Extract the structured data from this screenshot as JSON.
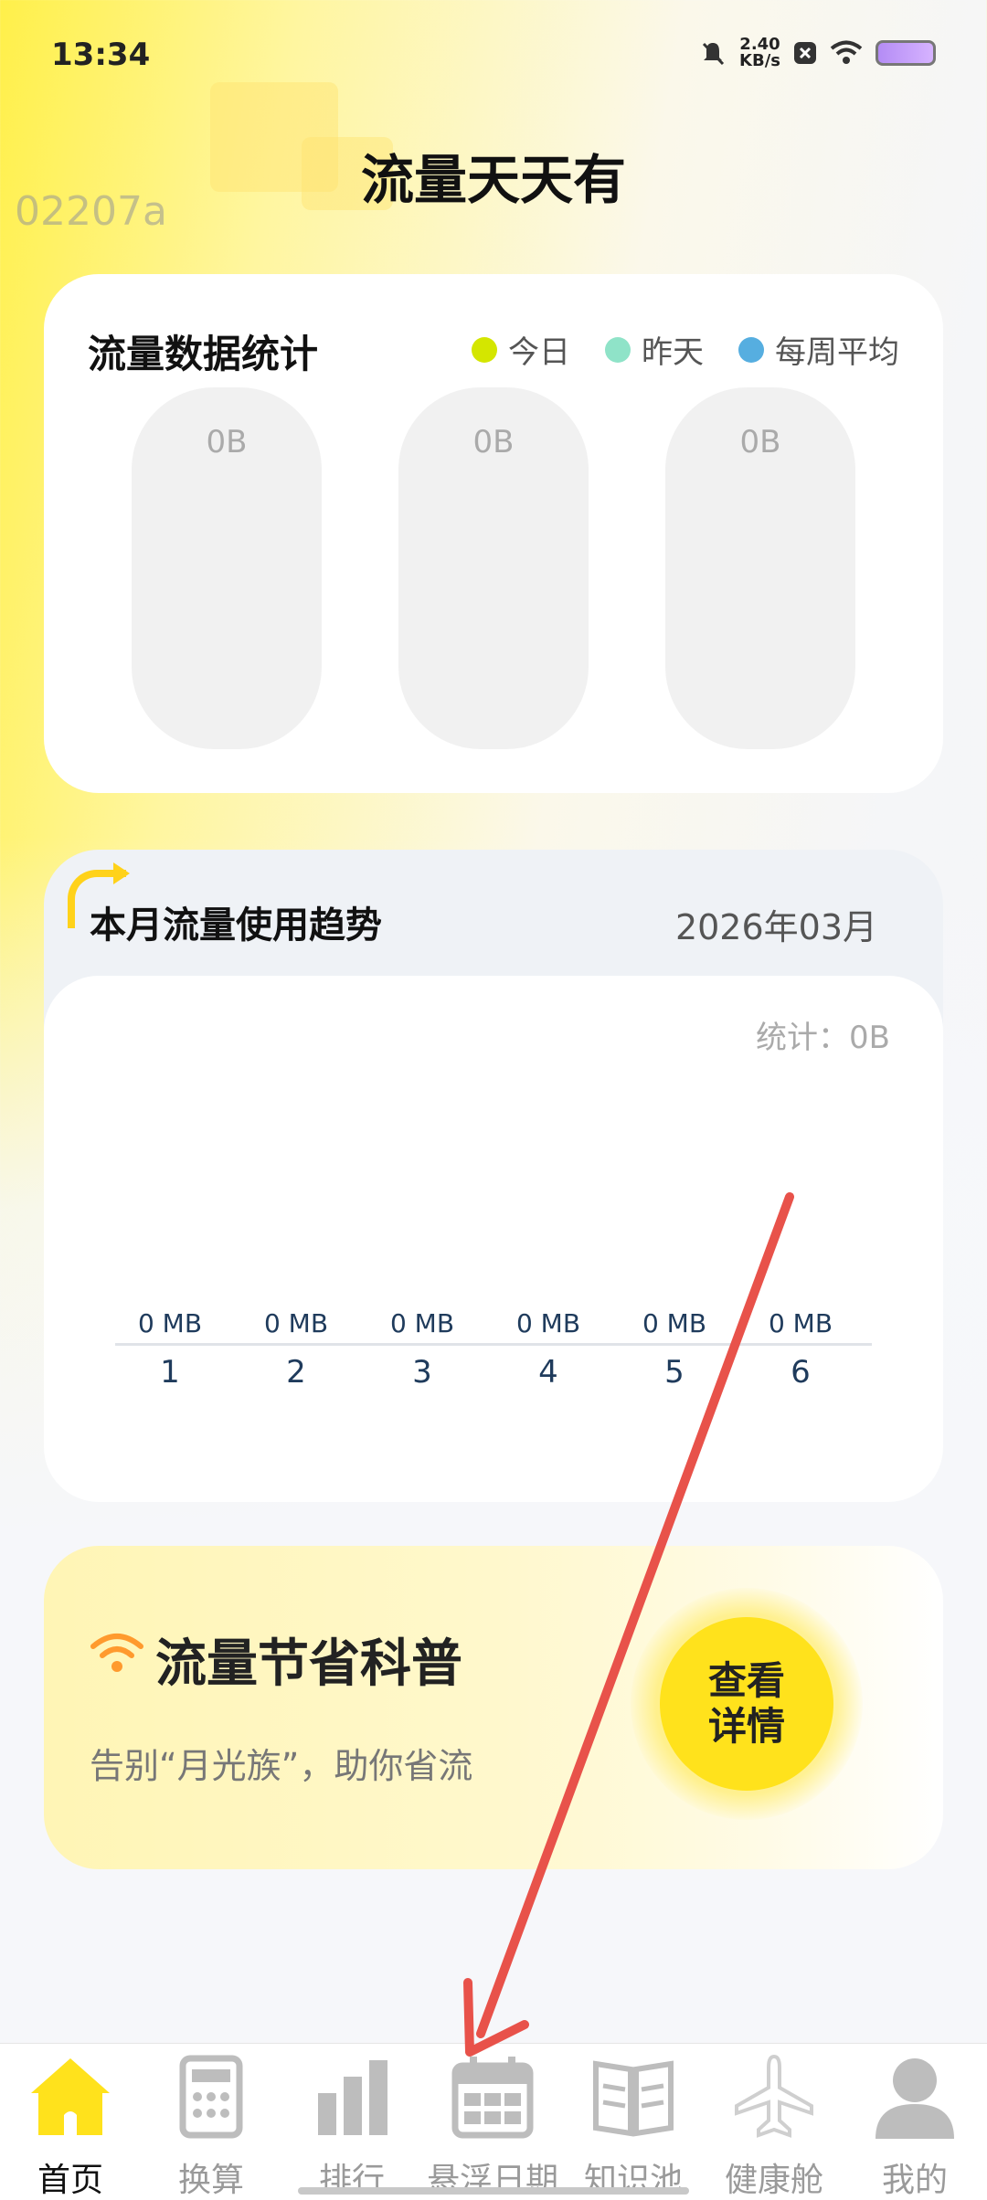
{
  "status_bar": {
    "time": "13:34",
    "net_speed_value": "2.40",
    "net_speed_unit": "KB/s",
    "icons": [
      "bell-off-icon",
      "close-box-icon",
      "wifi-icon",
      "battery-icon"
    ]
  },
  "watermark": "02207a",
  "page_title": "流量天天有",
  "stats_card": {
    "title": "流量数据统计",
    "legend": [
      {
        "label": "今日",
        "color": "#d4e600"
      },
      {
        "label": "昨天",
        "color": "#8fe3c8"
      },
      {
        "label": "每周平均",
        "color": "#56aee0"
      }
    ],
    "pills": [
      "0B",
      "0B",
      "0B"
    ]
  },
  "trend_card": {
    "title": "本月流量使用趋势",
    "month": "2026年03月",
    "stat": "统计：0B",
    "columns": [
      {
        "mb": "0 MB",
        "day": "1"
      },
      {
        "mb": "0 MB",
        "day": "2"
      },
      {
        "mb": "0 MB",
        "day": "3"
      },
      {
        "mb": "0 MB",
        "day": "4"
      },
      {
        "mb": "0 MB",
        "day": "5"
      },
      {
        "mb": "0 MB",
        "day": "6"
      }
    ]
  },
  "promo_card": {
    "title": "流量节省科普",
    "subtitle": "告别“月光族”，助你省流",
    "button_line1": "查看",
    "button_line2": "详情"
  },
  "bottom_nav": [
    {
      "label": "首页",
      "icon": "home-icon",
      "active": true
    },
    {
      "label": "换算",
      "icon": "calculator-icon",
      "active": false
    },
    {
      "label": "排行",
      "icon": "bar-chart-icon",
      "active": false
    },
    {
      "label": "悬浮日期",
      "icon": "calendar-icon",
      "active": false
    },
    {
      "label": "知识池",
      "icon": "book-icon",
      "active": false
    },
    {
      "label": "健康舱",
      "icon": "airplane-icon",
      "active": false
    },
    {
      "label": "我的",
      "icon": "user-icon",
      "active": false
    }
  ],
  "colors": {
    "accent_yellow": "#ffe21c",
    "annotation_arrow": "#e8524a"
  }
}
